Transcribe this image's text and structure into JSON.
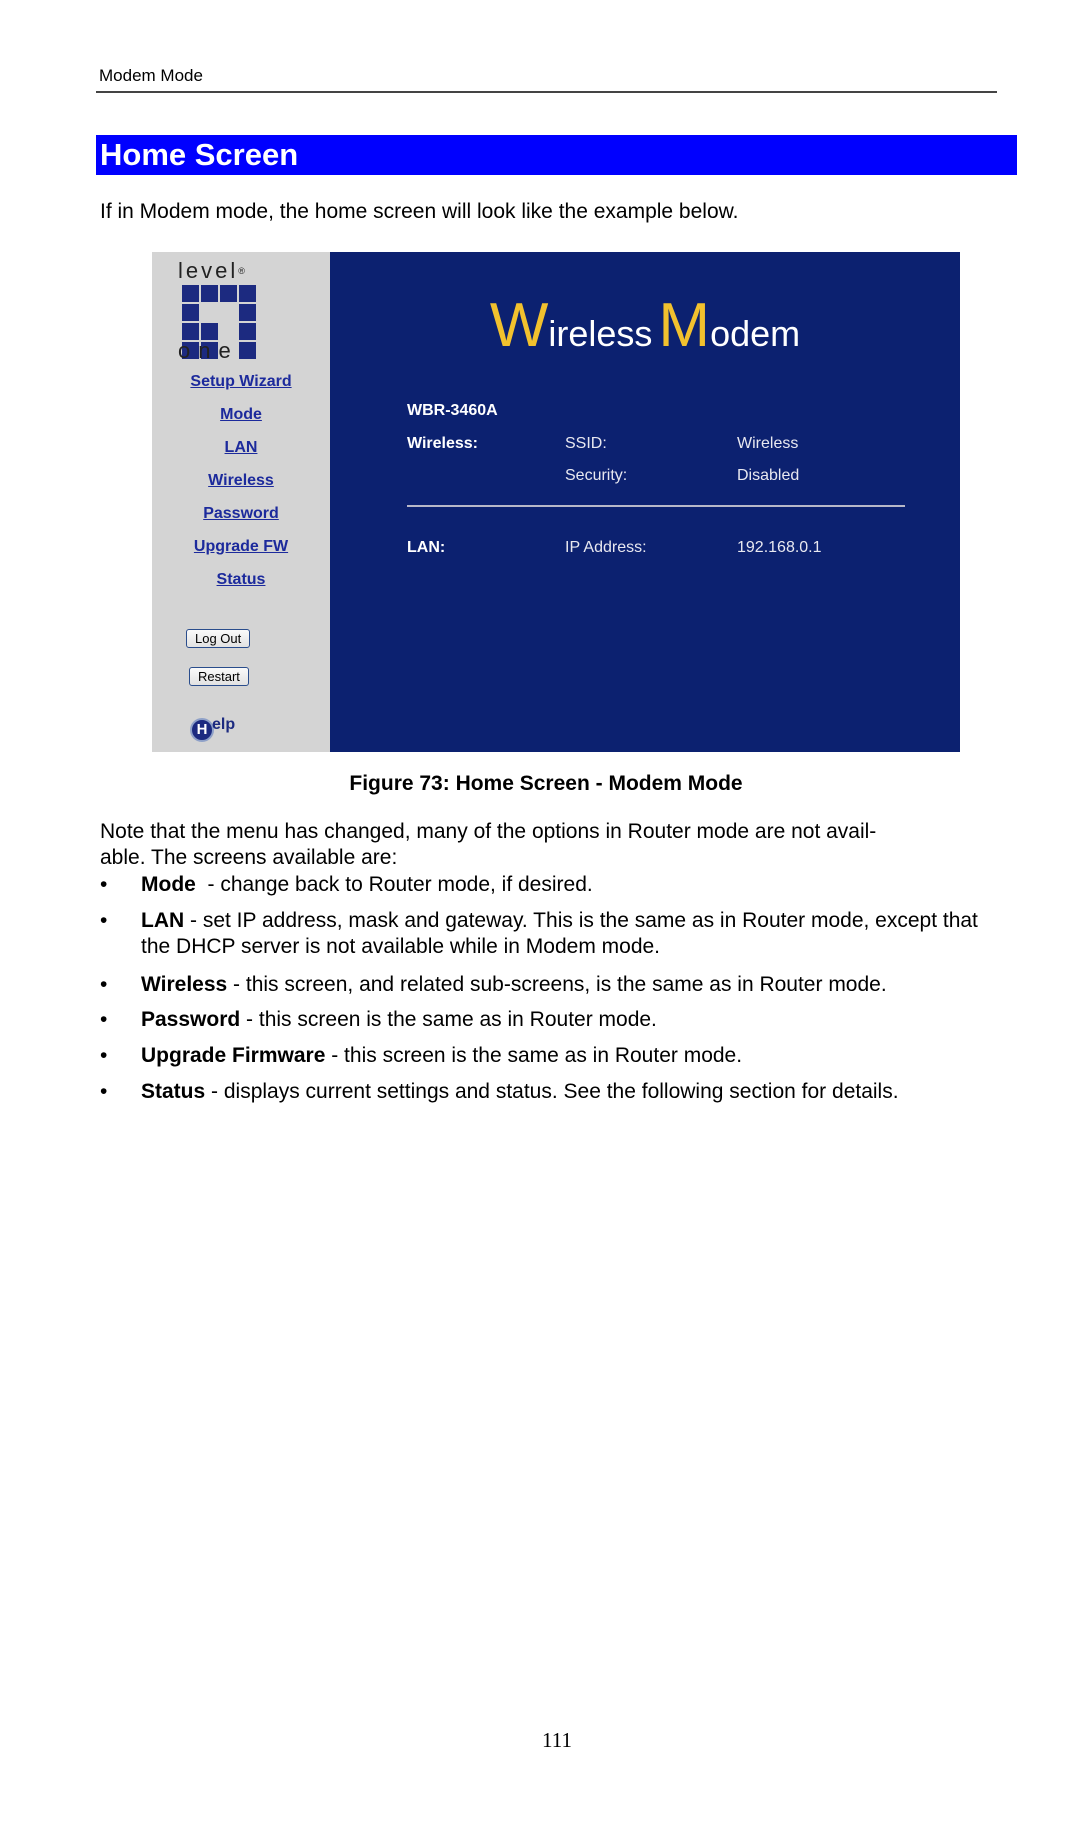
{
  "header": {
    "running_head": "Modem Mode"
  },
  "section": {
    "title": "Home Screen",
    "bar_color": "#0000ff"
  },
  "intro": "If in Modem mode, the home screen will look like the example below.",
  "screenshot": {
    "logo": {
      "top": "level",
      "reg": "®",
      "bottom": "one"
    },
    "nav": [
      "Setup Wizard",
      "Mode",
      "LAN",
      "Wireless",
      "Password",
      "Upgrade FW",
      "Status"
    ],
    "buttons": {
      "logout": "Log Out",
      "restart": "Restart"
    },
    "help": {
      "letter": "H",
      "text": "elp"
    },
    "brand": {
      "w": "W",
      "ireless": "ireless",
      "m": "M",
      "odem": "odem"
    },
    "model": "WBR-3460A",
    "rows": [
      {
        "section": "Wireless:",
        "label": "SSID:",
        "value": "Wireless"
      },
      {
        "section": "",
        "label": "Security:",
        "value": "Disabled"
      },
      {
        "section": "LAN:",
        "label": "IP Address:",
        "value": "192.168.0.1"
      }
    ],
    "colors": {
      "sidebar": "#d4d4d4",
      "main": "#0c2170",
      "accent": "#f2c12e"
    }
  },
  "caption": "Figure 73: Home Screen - Modem Mode",
  "note": "Note that the menu has changed, many of the options in Router mode are not avail-able. The screens available are:",
  "note_lines": [
    "Note that the menu has changed, many of the options in Router mode are not avail-",
    "able. The screens available are:"
  ],
  "bullets": [
    {
      "term": "Mode",
      "desc": "  - change back to Router mode, if desired."
    },
    {
      "term": "LAN",
      "desc": " - set IP address, mask and gateway. This is the same as in Router mode, except that the DHCP server is not available while in Modem mode."
    },
    {
      "term": "Wireless",
      "desc": " - this screen, and related sub-screens, is the same as in Router mode."
    },
    {
      "term": "Password",
      "desc": " - this screen is the same as in Router mode."
    },
    {
      "term": "Upgrade Firmware",
      "desc": " - this screen is the same as in Router mode."
    },
    {
      "term": "Status",
      "desc": " - displays current settings and status. See the following section for details."
    }
  ],
  "page_number": "111"
}
